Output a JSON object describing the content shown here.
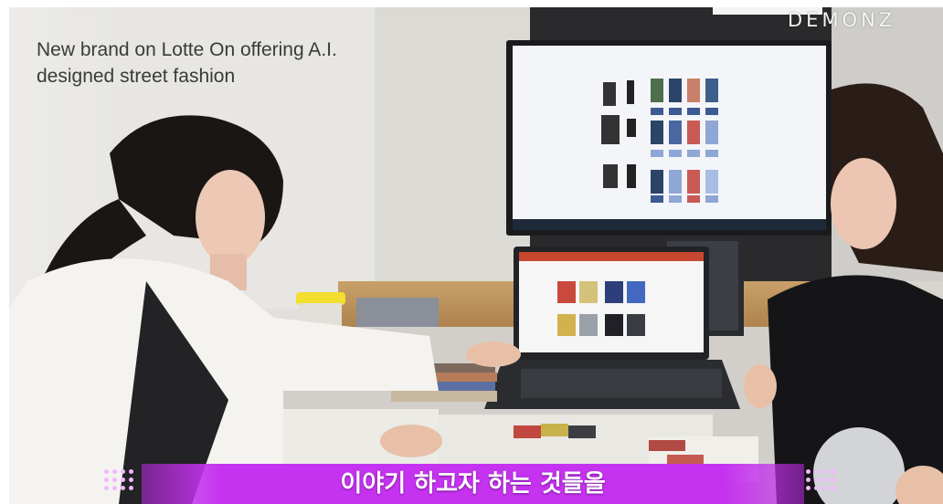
{
  "overlay": {
    "caption": "New brand on Lotte On offering A.I.\ndesigned street fashion",
    "logo": "DEMONZ",
    "subtitle": "이야기 하고자 하는 것들을"
  },
  "colors": {
    "subtitle_bar": "#c533f0",
    "dot_accent": "#f2b8ff",
    "caption_text": "#3a3a3a"
  }
}
